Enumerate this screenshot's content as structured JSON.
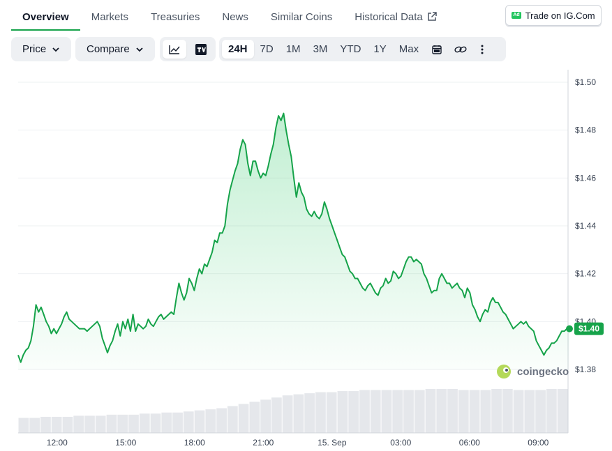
{
  "tabs": [
    {
      "label": "Overview",
      "active": true
    },
    {
      "label": "Markets"
    },
    {
      "label": "Treasuries"
    },
    {
      "label": "News"
    },
    {
      "label": "Similar Coins"
    },
    {
      "label": "Historical Data",
      "icon": "external-link-icon"
    }
  ],
  "ig_button": {
    "badge": "Ad",
    "label": "Trade on IG.Com"
  },
  "toolbar": {
    "price_label": "Price",
    "compare_label": "Compare",
    "chart_type_icons": [
      "line-chart-icon",
      "tradingview-icon"
    ],
    "ranges": [
      "24H",
      "7D",
      "1M",
      "3M",
      "YTD",
      "1Y",
      "Max"
    ],
    "selected_range": "24H",
    "extra_icons": [
      "calendar-icon",
      "link-icon",
      "more-icon"
    ]
  },
  "watermark": "coingecko",
  "colors": {
    "line": "#16a34a",
    "accent": "#16a34a",
    "volume": "#e5e7eb",
    "grid": "#eef0f2"
  },
  "chart_data": {
    "type": "line",
    "ylim": [
      1.38,
      1.5
    ],
    "yticks": [
      "$1.50",
      "$1.48",
      "$1.46",
      "$1.44",
      "$1.42",
      "$1.40",
      "$1.38"
    ],
    "ytick_values": [
      1.5,
      1.48,
      1.46,
      1.44,
      1.42,
      1.4,
      1.38
    ],
    "xticks": [
      "12:00",
      "15:00",
      "18:00",
      "21:00",
      "15. Sep",
      "03:00",
      "06:00",
      "09:00"
    ],
    "xtick_hours": [
      1.7,
      4.7,
      7.7,
      10.7,
      13.7,
      16.7,
      19.7,
      22.7
    ],
    "last_price_label": "$1.40",
    "grid": true,
    "series": [
      {
        "values": [
          1.386,
          1.383,
          1.386,
          1.388,
          1.389,
          1.392,
          1.398,
          1.407,
          1.404,
          1.406,
          1.403,
          1.4,
          1.398,
          1.395,
          1.397,
          1.395,
          1.397,
          1.399,
          1.402,
          1.404,
          1.401,
          1.4,
          1.399,
          1.398,
          1.397,
          1.397,
          1.397,
          1.396,
          1.397,
          1.398,
          1.399,
          1.4,
          1.398,
          1.393,
          1.39,
          1.387,
          1.39,
          1.392,
          1.396,
          1.399,
          1.394,
          1.4,
          1.397,
          1.401,
          1.396,
          1.403,
          1.396,
          1.399,
          1.398,
          1.397,
          1.398,
          1.401,
          1.399,
          1.398,
          1.4,
          1.402,
          1.403,
          1.401,
          1.402,
          1.403,
          1.404,
          1.403,
          1.41,
          1.416,
          1.412,
          1.409,
          1.412,
          1.418,
          1.416,
          1.413,
          1.418,
          1.422,
          1.42,
          1.424,
          1.423,
          1.426,
          1.429,
          1.434,
          1.433,
          1.437,
          1.437,
          1.44,
          1.449,
          1.455,
          1.459,
          1.463,
          1.466,
          1.472,
          1.476,
          1.474,
          1.466,
          1.461,
          1.467,
          1.467,
          1.463,
          1.46,
          1.462,
          1.461,
          1.465,
          1.47,
          1.474,
          1.481,
          1.486,
          1.484,
          1.487,
          1.48,
          1.474,
          1.469,
          1.46,
          1.452,
          1.458,
          1.454,
          1.452,
          1.447,
          1.445,
          1.444,
          1.446,
          1.444,
          1.443,
          1.445,
          1.45,
          1.447,
          1.443,
          1.44,
          1.437,
          1.434,
          1.431,
          1.428,
          1.427,
          1.424,
          1.421,
          1.42,
          1.418,
          1.418,
          1.416,
          1.414,
          1.413,
          1.415,
          1.416,
          1.414,
          1.412,
          1.411,
          1.414,
          1.415,
          1.418,
          1.416,
          1.417,
          1.421,
          1.42,
          1.418,
          1.419,
          1.422,
          1.425,
          1.427,
          1.427,
          1.425,
          1.426,
          1.425,
          1.424,
          1.42,
          1.418,
          1.415,
          1.412,
          1.413,
          1.413,
          1.418,
          1.42,
          1.418,
          1.416,
          1.416,
          1.414,
          1.415,
          1.416,
          1.414,
          1.413,
          1.41,
          1.414,
          1.412,
          1.407,
          1.405,
          1.402,
          1.4,
          1.403,
          1.405,
          1.404,
          1.408,
          1.41,
          1.408,
          1.408,
          1.406,
          1.404,
          1.403,
          1.401,
          1.399,
          1.397,
          1.398,
          1.399,
          1.4,
          1.399,
          1.4,
          1.398,
          1.397,
          1.396,
          1.392,
          1.39,
          1.388,
          1.386,
          1.388,
          1.389,
          1.391,
          1.391,
          1.392,
          1.394,
          1.396,
          1.396,
          1.397,
          1.397
        ]
      }
    ],
    "volume": [
      0.14,
      0.14,
      0.15,
      0.15,
      0.15,
      0.16,
      0.16,
      0.16,
      0.17,
      0.17,
      0.17,
      0.18,
      0.18,
      0.19,
      0.19,
      0.2,
      0.21,
      0.22,
      0.23,
      0.25,
      0.27,
      0.29,
      0.31,
      0.33,
      0.35,
      0.36,
      0.37,
      0.38,
      0.38,
      0.39,
      0.39,
      0.4,
      0.4,
      0.4,
      0.4,
      0.4,
      0.4,
      0.41,
      0.41,
      0.41,
      0.4,
      0.4,
      0.4,
      0.41,
      0.41,
      0.4,
      0.4,
      0.4,
      0.41,
      0.41
    ]
  }
}
